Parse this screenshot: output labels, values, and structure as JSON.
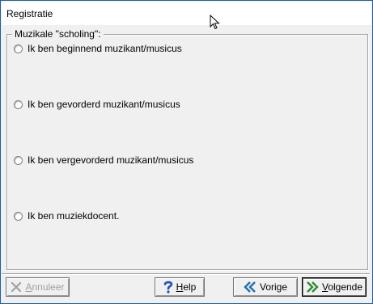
{
  "window": {
    "title": "Registratie"
  },
  "group": {
    "legend": "Muzikale \"scholing\":",
    "options": [
      {
        "label": "Ik ben beginnend muzikant/musicus",
        "selected": false
      },
      {
        "label": "Ik ben gevorderd muzikant/musicus",
        "selected": false
      },
      {
        "label": "Ik ben vergevorderd muzikant/musicus",
        "selected": false
      },
      {
        "label": "Ik ben muziekdocent.",
        "selected": false
      }
    ]
  },
  "buttons": {
    "cancel": {
      "first": "A",
      "rest": "nnuleer",
      "enabled": false
    },
    "help": {
      "first": "H",
      "rest": "elp"
    },
    "previous": {
      "label": "Vorige"
    },
    "next": {
      "first": "V",
      "rest": "olgende"
    }
  },
  "colors": {
    "accent": "#1e5fa8",
    "help_icon": "#1f4fbf",
    "arrow_icon": "#1e6fb0",
    "next_arrow": "#2f8a2f"
  }
}
